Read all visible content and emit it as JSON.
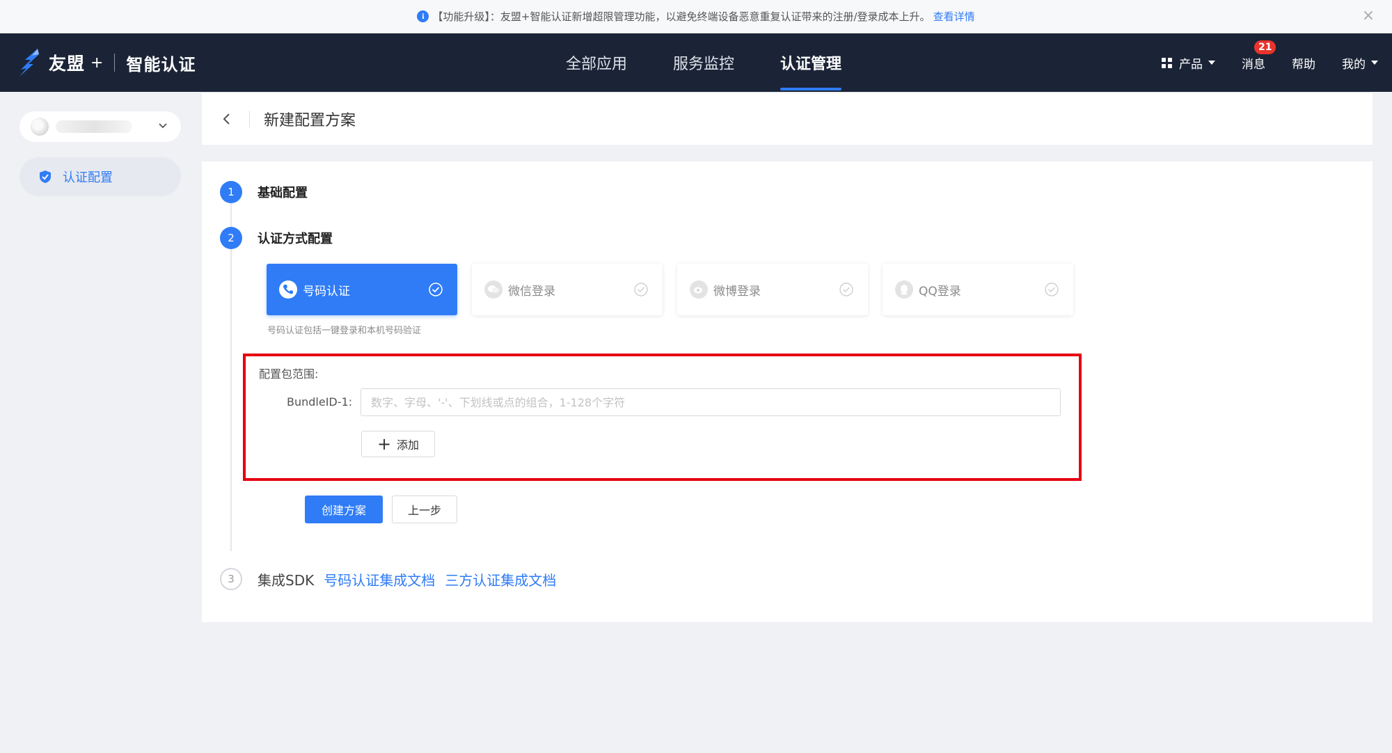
{
  "notice": {
    "text": "【功能升级】：友盟+智能认证新增超限管理功能，以避免终端设备恶意重复认证带来的注册/登录成本上升。",
    "link": "查看详情",
    "close": "×"
  },
  "header": {
    "brand": "友盟",
    "plus": "+",
    "product": "智能认证",
    "nav": [
      "全部应用",
      "服务监控",
      "认证管理"
    ],
    "active_nav": "认证管理",
    "products_label": "产品",
    "messages_label": "消息",
    "messages_badge": "21",
    "help_label": "帮助",
    "mine_label": "我的"
  },
  "sidebar": {
    "items": [
      {
        "label": "认证配置",
        "icon": "shield-icon"
      }
    ]
  },
  "page": {
    "title": "新建配置方案"
  },
  "steps": [
    {
      "number": "1",
      "label": "基础配置"
    },
    {
      "number": "2",
      "label": "认证方式配置"
    },
    {
      "number": "3",
      "label": "集成SDK",
      "links": [
        "号码认证集成文档",
        "三方认证集成文档"
      ]
    }
  ],
  "auth_methods": [
    {
      "label": "号码认证",
      "icon": "phone-icon",
      "selected": true
    },
    {
      "label": "微信登录",
      "icon": "wechat-icon",
      "selected": false
    },
    {
      "label": "微博登录",
      "icon": "weibo-icon",
      "selected": false
    },
    {
      "label": "QQ登录",
      "icon": "qq-icon",
      "selected": false
    }
  ],
  "helper_text": "号码认证包括一键登录和本机号码验证",
  "scope": {
    "label": "配置包范围:",
    "bundle_label": "BundleID-1:",
    "bundle_value": "",
    "bundle_placeholder": "数字、字母、'-'、下划线或点的组合，1-128个字符",
    "add_label": "添加"
  },
  "actions": {
    "create": "创建方案",
    "prev": "上一步"
  },
  "colors": {
    "primary": "#2f7cf6",
    "header_bg": "#1b2436",
    "highlight": "#e60012",
    "badge": "#e8342d"
  }
}
